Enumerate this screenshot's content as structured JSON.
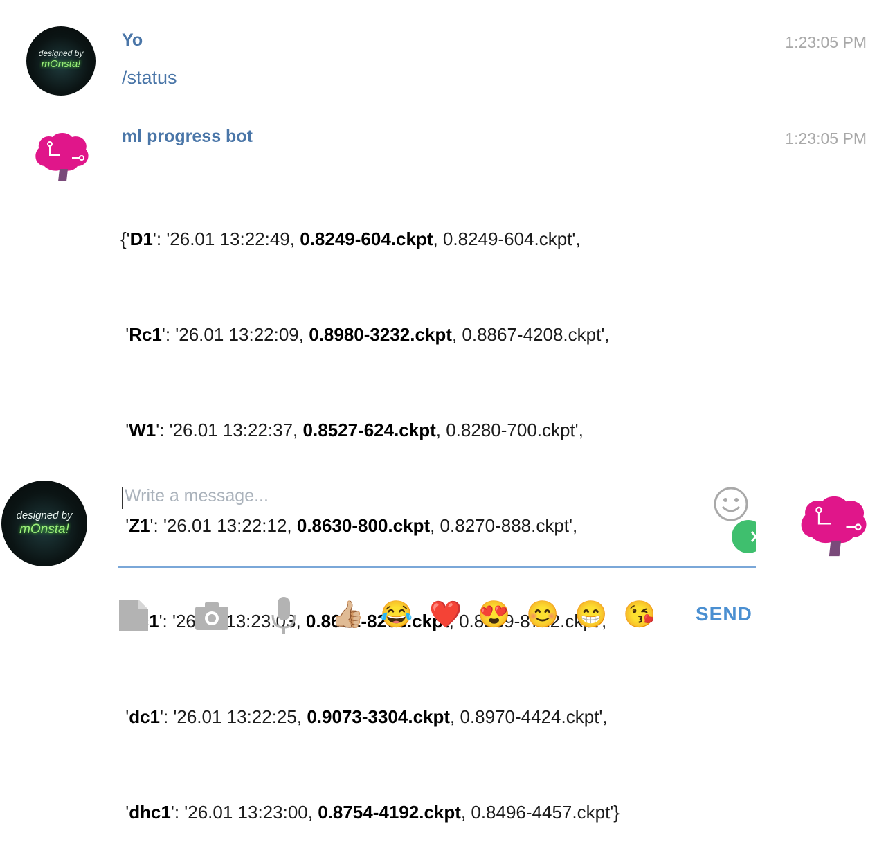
{
  "messages": [
    {
      "sender": "Yo",
      "time": "1:23:05 PM",
      "text": "/status",
      "avatar": {
        "line1": "designed by",
        "line2": "mOnsta!"
      }
    },
    {
      "sender": "ml progress bot",
      "time": "1:23:05 PM",
      "lines": [
        {
          "prefix": "{'",
          "key": "D1",
          "mid": "': '26.01 13:22:49, ",
          "best": "0.8249-604.ckpt",
          "rest": ", 0.8249-604.ckpt',"
        },
        {
          "prefix": " '",
          "key": "Rc1",
          "mid": "': '26.01 13:22:09, ",
          "best": "0.8980-3232.ckpt",
          "rest": ", 0.8867-4208.ckpt',"
        },
        {
          "prefix": " '",
          "key": "W1",
          "mid": "': '26.01 13:22:37, ",
          "best": "0.8527-624.ckpt",
          "rest": ", 0.8280-700.ckpt',"
        },
        {
          "prefix": " '",
          "key": "Z1",
          "mid": "': '26.01 13:22:12, ",
          "best": "0.8630-800.ckpt",
          "rest": ", 0.8270-888.ckpt',"
        },
        {
          "prefix": " '",
          "key": "cc1",
          "mid": "': '26.01 13:23:03, ",
          "best": "0.8682-8208.ckpt",
          "rest": ", 0.8239-8722.ckpt',"
        },
        {
          "prefix": " '",
          "key": "dc1",
          "mid": "': '26.01 13:22:25, ",
          "best": "0.9073-3304.ckpt",
          "rest": ", 0.8970-4424.ckpt',"
        },
        {
          "prefix": " '",
          "key": "dhc1",
          "mid": "': '26.01 13:23:00, ",
          "best": "0.8754-4192.ckpt",
          "rest": ", 0.8496-4457.ckpt'}"
        }
      ]
    }
  ],
  "composer": {
    "placeholder": "Write a message...",
    "avatar": {
      "line1": "designed by",
      "line2": "mOnsta!"
    },
    "send_label": "SEND",
    "icons": [
      "file-icon",
      "camera-icon",
      "microphone-icon"
    ],
    "emojis": [
      "👍🏼",
      "😂",
      "❤️",
      "😍",
      "😊",
      "😁",
      "😘"
    ]
  },
  "colors": {
    "accent": "#4a76a8",
    "send": "#4a8fd1",
    "timestamp": "#a8a8a8",
    "bot_brain": "#e0168a",
    "input_line": "#7aa7d8"
  }
}
